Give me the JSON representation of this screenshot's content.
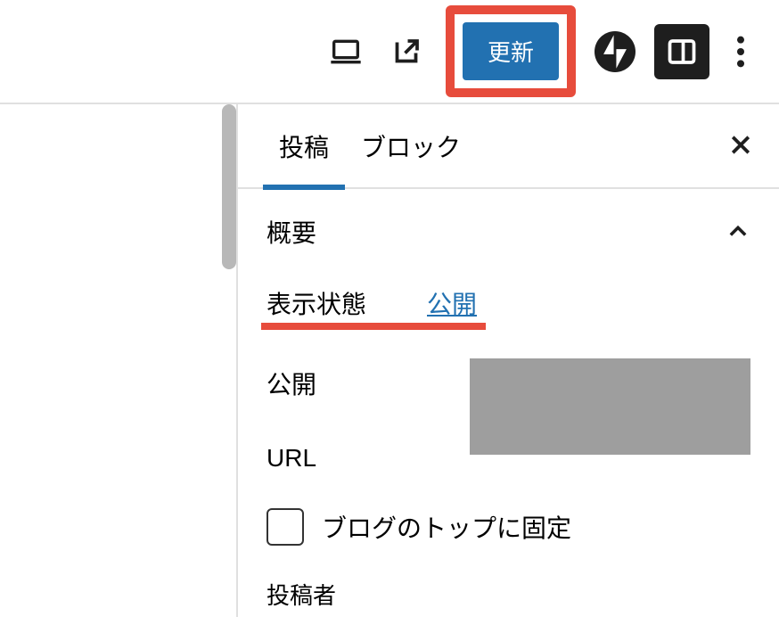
{
  "toolbar": {
    "update_label": "更新"
  },
  "sidebar": {
    "tabs": {
      "post": "投稿",
      "block": "ブロック"
    },
    "summary": {
      "title": "概要",
      "visibility_label": "表示状態",
      "visibility_value": "公開",
      "publish_label": "公開",
      "url_label": "URL",
      "stick_checkbox_label": "ブログのトップに固定",
      "author_label": "投稿者"
    }
  },
  "icons": {
    "laptop": "laptop-icon",
    "external": "external-link-icon",
    "jetpack": "jetpack-icon",
    "panel": "panel-icon",
    "more": "more-icon",
    "close": "close-icon",
    "chevron_up": "chevron-up-icon"
  }
}
